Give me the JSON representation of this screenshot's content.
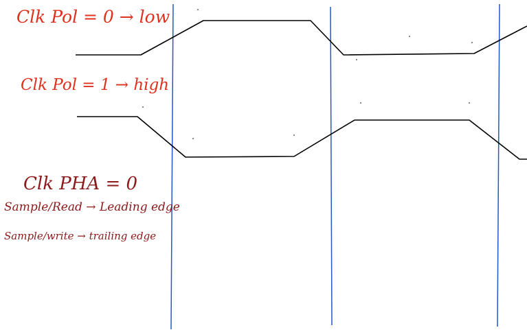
{
  "annotations": {
    "cpol0": "Clk Pol = 0 → low",
    "cpol1": "Clk Pol = 1 → high",
    "cpha": "Clk PHA = 0",
    "sample_read": "Sample/Read → Leading edge",
    "sample_write": "Sample/write → trailing edge"
  },
  "colors": {
    "annotation_red": "#e0301e",
    "annotation_dark_red": "#8b1a1a",
    "waveform": "#000000",
    "edge_marker": "#2457c5",
    "background": "#ffffff"
  },
  "waveforms": [
    {
      "polarity": "CPOL=0",
      "idle_level": "low",
      "levels": [
        "low",
        "high",
        "low",
        "high"
      ]
    },
    {
      "polarity": "CPOL=1",
      "idle_level": "high",
      "levels": [
        "high",
        "low",
        "high",
        "low"
      ]
    }
  ]
}
